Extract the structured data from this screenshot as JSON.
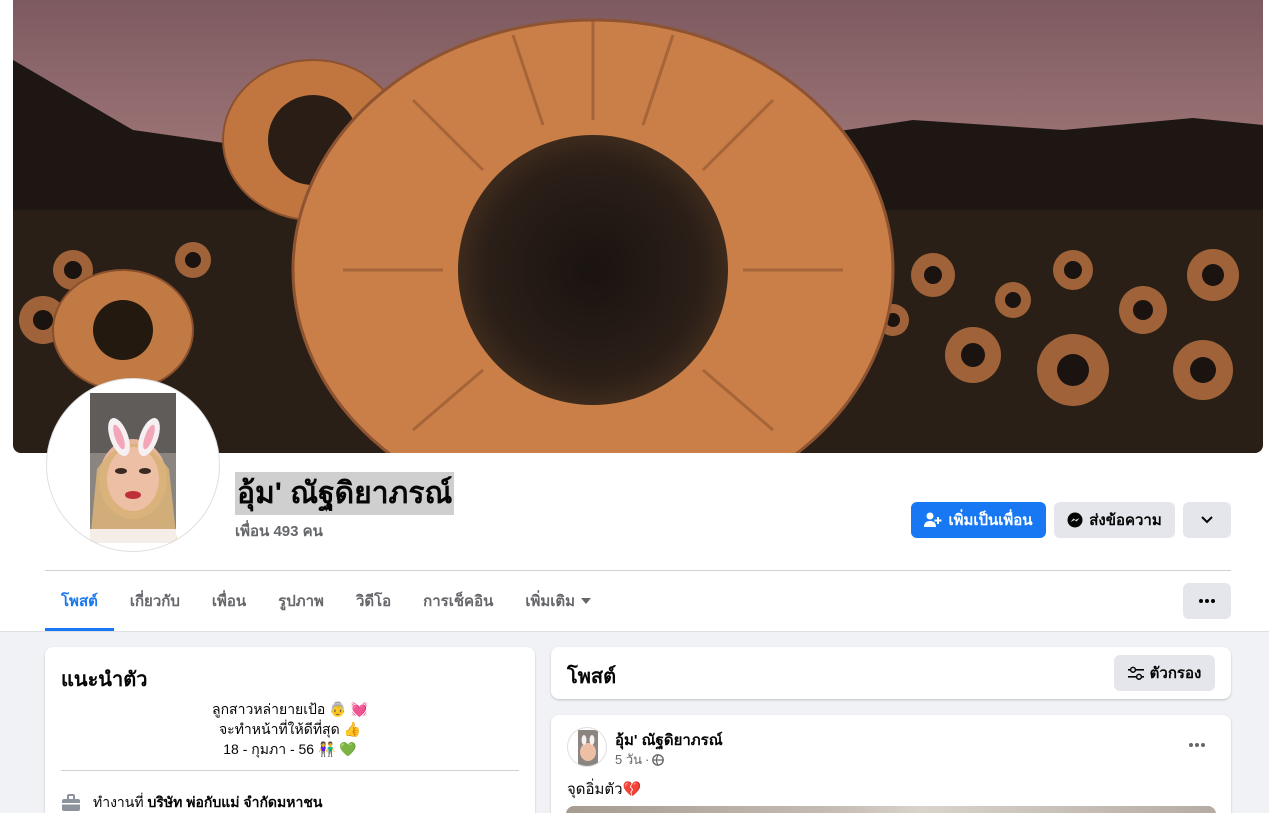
{
  "profile": {
    "name": "อุ้ม' ณัฐดิยาภรณ์",
    "friends_text": "เพื่อน 493 คน"
  },
  "actions": {
    "add_friend": "เพิ่มเป็นเพื่อน",
    "message": "ส่งข้อความ"
  },
  "tabs": [
    {
      "label": "โพสต์",
      "active": true
    },
    {
      "label": "เกี่ยวกับ",
      "active": false
    },
    {
      "label": "เพื่อน",
      "active": false
    },
    {
      "label": "รูปภาพ",
      "active": false
    },
    {
      "label": "วิดีโอ",
      "active": false
    },
    {
      "label": "การเช็คอิน",
      "active": false
    },
    {
      "label": "เพิ่มเติม",
      "active": false
    }
  ],
  "intro": {
    "title": "แนะนำตัว",
    "bio_lines": [
      "ลูกสาวหล่ายายเป้อ 👵 💓",
      "จะทำหน้าที่ให้ดีที่สุด 👍",
      "18 - กุมภา - 56 👫 💚"
    ],
    "work_prefix": "ทำงานที่",
    "work_place": "บริษัท พ่อกับแม่ จำกัดมหาชน"
  },
  "posts": {
    "title": "โพสต์",
    "filter_label": "ตัวกรอง",
    "items": [
      {
        "author": "อุ้ม' ณัฐดิยาภรณ์",
        "time": "5 วัน",
        "separator": "·",
        "text": "จุดอิ่มตัว💔"
      }
    ]
  },
  "colors": {
    "primary": "#1877f2",
    "secondary_bg": "#e4e6eb",
    "muted_text": "#65676b",
    "page_bg": "#f0f2f5"
  },
  "icons": {
    "add_friend": "person-plus-icon",
    "message": "messenger-icon",
    "chevron": "chevron-down-icon",
    "more": "more-dots-icon",
    "filter": "filter-sliders-icon",
    "work": "briefcase-icon",
    "privacy": "globe-icon"
  }
}
